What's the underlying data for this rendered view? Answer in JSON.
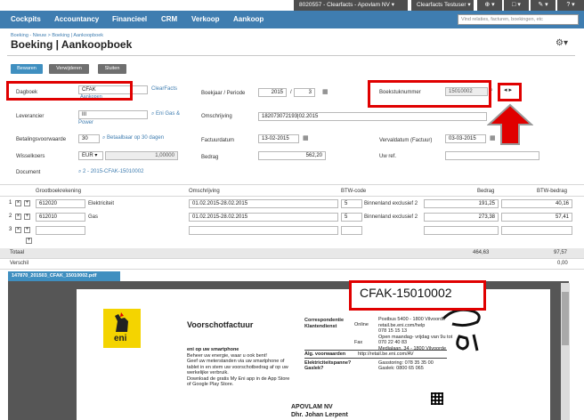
{
  "topbar": {
    "company": "8020557 - Clearfacts - Apovlam NV",
    "user": "Clearfacts Testuser",
    "btn_add": "⊕ ▾",
    "btn_doc": "□ ▾",
    "btn_edit": "✎ ▾",
    "btn_help": "? ▾"
  },
  "nav": {
    "items": [
      "Cockpits",
      "Accountancy",
      "Financieel",
      "CRM",
      "Verkoop",
      "Aankoop"
    ],
    "search_placeholder": "Vind relaties, facturen, boekingen, etc"
  },
  "breadcrumb": "Boeking - Nieuw > Boeking | Aankoopboek",
  "title": "Boeking | Aankoopboek",
  "buttons": {
    "save": "Bewaren",
    "delete": "Verwijderen",
    "close": "Sluiten"
  },
  "form": {
    "dagboek_label": "Dagboek",
    "dagboek_value": "CFAK",
    "dagboek_sub": "Aankopen",
    "dagboek_link": "ClearFacts",
    "boekjaar_label": "Boekjaar / Periode",
    "boekjaar_value": "2015",
    "periode_sep": "/",
    "periode_value": "3",
    "boekstuk_label": "Boekstuknummer",
    "boekstuk_value": "15010002",
    "leverancier_label": "Leverancier",
    "leverancier_value": "III",
    "leverancier_link": "Eni Gas &",
    "leverancier_link2": "Power",
    "omschrijving_label": "Omschrijving",
    "omschrijving_value": "182073072193|02.2015",
    "betalingsvoorwaarde_label": "Betalingsvoorwaarde",
    "betalingsvoorwaarde_value": "30",
    "betalingsvoorwaarde_link": "Betaalbaar op 30 dagen",
    "factuurdatum_label": "Factuurdatum",
    "factuurdatum_value": "13-02-2015",
    "vervaldatum_label": "Vervaldatum (Factuur)",
    "vervaldatum_value": "03-03-2015",
    "wisselkoers_label": "Wisselkoers",
    "currency_value": "EUR ▾",
    "wisselkoers_value": "1,00000",
    "bedrag_label": "Bedrag",
    "bedrag_value": "562,20",
    "uwref_label": "Uw ref.",
    "uwref_value": "",
    "document_label": "Document",
    "document_link": "2 - 2015-CFAK-15010002"
  },
  "grid": {
    "headers": [
      "Grootboekrekening",
      "Omschrijving",
      "BTW-code",
      "Bedrag",
      "BTW-bedrag"
    ],
    "rows": [
      {
        "num": "1",
        "account": "612020",
        "account_name": "Elektriciteit",
        "description": "01.02.2015-28.02.2015",
        "vat": "5",
        "vat_name": "Binnenland exclusief 2",
        "amount": "191,25",
        "vat_amount": "40,16"
      },
      {
        "num": "2",
        "account": "612010",
        "account_name": "Gas",
        "description": "01.02.2015-28.02.2015",
        "vat": "5",
        "vat_name": "Binnenland exclusief 2",
        "amount": "273,38",
        "vat_amount": "57,41"
      },
      {
        "num": "3",
        "account": "",
        "account_name": "",
        "description": "",
        "vat": "",
        "vat_name": "",
        "amount": "",
        "vat_amount": ""
      }
    ],
    "totaal_label": "Totaal",
    "totaal_amount": "464,63",
    "totaal_vat": "97,57",
    "verschil_label": "Verschil",
    "verschil_value": "0,00"
  },
  "attachment": {
    "tab": "147870_201503_CFAK_15010002.pdf",
    "stamp": "CFAK-15010002",
    "doc_title": "Voorschotfactuur",
    "brand": "eni",
    "promo_lines": [
      "eni op uw smartphone",
      "Beheer uw energie, waar u ook bent!",
      "Geef uw meterstanden via uw smartphone of",
      "tablet in en stem uw voorschotbedrag af op uw",
      "werkelijke verbruik.",
      "Download de gratis My Eni app in de App Store",
      "of Google Play Store."
    ],
    "contact_labels": [
      "Correspondentie",
      "Klantendienst"
    ],
    "contact_lines": [
      "Postbus 5400 - 1800 Vilvoorde",
      "retail.be.eni.com/help",
      "078 15 15 13",
      "Open maandag- vrijdag van 9u tot",
      "070 22 40 83",
      "Medialaan, 34 - 1800 Vilvoorde"
    ],
    "contact_keys": [
      "Online",
      "",
      "Fax",
      ""
    ],
    "general_label": "Alg. voorwaarden",
    "general_value": "http://retail.be.eni.com/AV",
    "storing_labels": [
      "Elektriciteitspanne?",
      "Gaslek?"
    ],
    "storing_lines": [
      "Gasstoring: 078 35 35 00",
      "Gaslek: 0800 65 065"
    ],
    "recipient": "APOVLAM NV",
    "recipient2": "Dhr. Johan Lerpent"
  }
}
